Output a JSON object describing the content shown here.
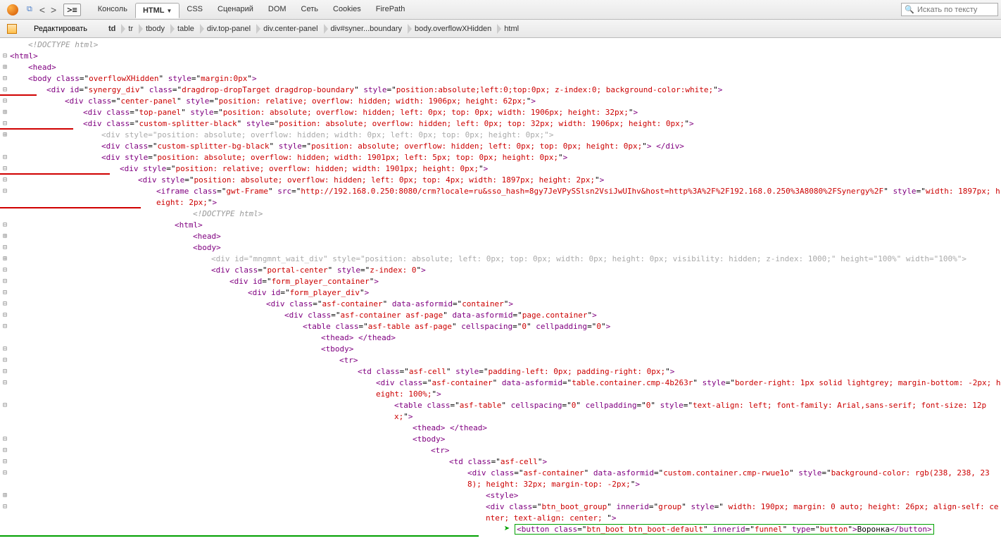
{
  "toolbar": {
    "tabs": [
      "Консоль",
      "HTML",
      "CSS",
      "Сценарий",
      "DOM",
      "Сеть",
      "Cookies",
      "FirePath"
    ],
    "active_tab": "HTML",
    "search_placeholder": "Искать по тексту",
    "edit_label": "Редактировать"
  },
  "breadcrumb": [
    "td",
    "tr",
    "tbody",
    "table",
    "div.top-panel",
    "div.center-panel",
    "div#syner...boundary",
    "body.overflowXHidden",
    "html"
  ],
  "tree": [
    {
      "d": 1,
      "tw": "",
      "cls": "c-doctype",
      "html": "&lt;!DOCTYPE html&gt;"
    },
    {
      "d": 0,
      "tw": "⊟",
      "html": "<span class='c-br'>&lt;</span><span class='c-tag'>html</span><span class='c-br'>&gt;</span>"
    },
    {
      "d": 1,
      "tw": "⊞",
      "html": "<span class='c-br'>&lt;</span><span class='c-tag'>head</span><span class='c-br'>&gt;</span>"
    },
    {
      "d": 1,
      "tw": "⊟",
      "html": "<span class='c-br'>&lt;</span><span class='c-tag'>body</span> <span class='c-attr'>class</span>=\"<span class='c-val'>overflowXHidden</span>\" <span class='c-attr'>style</span>=\"<span class='c-val'>margin:0px</span>\"<span class='c-br'>&gt;</span>"
    },
    {
      "d": 2,
      "tw": "⊟",
      "red": 1,
      "html": "<span class='c-br'>&lt;</span><span class='c-tag'>div</span> <span class='c-attr'>id</span>=\"<span class='c-val'>synergy_div</span>\" <span class='c-attr'>class</span>=\"<span class='c-val'>dragdrop-dropTarget dragdrop-boundary</span>\" <span class='c-attr'>style</span>=\"<span class='c-val'>position:absolute;left:0;top:0px; z-index:0; background-color:white;</span>\"<span class='c-br'>&gt;</span>"
    },
    {
      "d": 3,
      "tw": "⊟",
      "html": "<span class='c-br'>&lt;</span><span class='c-tag'>div</span> <span class='c-attr'>class</span>=\"<span class='c-val'>center-panel</span>\" <span class='c-attr'>style</span>=\"<span class='c-val'>position: relative; overflow: hidden; width: 1906px; height: 62px;</span>\"<span class='c-br'>&gt;</span>"
    },
    {
      "d": 4,
      "tw": "⊞",
      "html": "<span class='c-br'>&lt;</span><span class='c-tag'>div</span> <span class='c-attr'>class</span>=\"<span class='c-val'>top-panel</span>\" <span class='c-attr'>style</span>=\"<span class='c-val'>position: absolute; overflow: hidden; left: 0px; top: 0px; width: 1906px; height: 32px;</span>\"<span class='c-br'>&gt;</span>"
    },
    {
      "d": 4,
      "tw": "⊟",
      "red": 1,
      "html": "<span class='c-br'>&lt;</span><span class='c-tag'>div</span> <span class='c-attr'>class</span>=\"<span class='c-val'>custom-splitter-black</span>\" <span class='c-attr'>style</span>=\"<span class='c-val'>position: absolute; overflow: hidden; left: 0px; top: 32px; width: 1906px; height: 0px;</span>\"<span class='c-br'>&gt;</span>"
    },
    {
      "d": 5,
      "tw": "⊞",
      "grey": 1,
      "html": "<span class='c-br'>&lt;</span><span class='c-tag'>div</span> <span class='c-attr'>style</span>=\"<span class='c-val'>position: absolute; overflow: hidden; width: 0px; left: 0px; top: 0px; height: 0px;</span>\"<span class='c-br'>&gt;</span>"
    },
    {
      "d": 5,
      "tw": "",
      "html": "<span class='c-br'>&lt;</span><span class='c-tag'>div</span> <span class='c-attr'>class</span>=\"<span class='c-val'>custom-splitter-bg-black</span>\" <span class='c-attr'>style</span>=\"<span class='c-val'>position: absolute; overflow: hidden; left: 0px; top: 0px; height: 0px;</span>\"<span class='c-br'>&gt;</span> <span class='c-br'>&lt;/</span><span class='c-tag'>div</span><span class='c-br'>&gt;</span>"
    },
    {
      "d": 5,
      "tw": "⊟",
      "html": "<span class='c-br'>&lt;</span><span class='c-tag'>div</span> <span class='c-attr'>style</span>=\"<span class='c-val'>position: absolute; overflow: hidden; width: 1901px; left: 5px; top: 0px; height: 0px;</span>\"<span class='c-br'>&gt;</span>"
    },
    {
      "d": 6,
      "tw": "⊟",
      "red": 1,
      "html": "<span class='c-br'>&lt;</span><span class='c-tag'>div</span> <span class='c-attr'>style</span>=\"<span class='c-val'>position: relative; overflow: hidden; width: 1901px; height: 0px;</span>\"<span class='c-br'>&gt;</span>"
    },
    {
      "d": 7,
      "tw": "⊟",
      "html": "<span class='c-br'>&lt;</span><span class='c-tag'>div</span> <span class='c-attr'>style</span>=\"<span class='c-val'>position: absolute; overflow: hidden; left: 0px; top: 4px; width: 1897px; height: 2px;</span>\"<span class='c-br'>&gt;</span>"
    },
    {
      "d": 8,
      "tw": "⊟",
      "redshort": 1,
      "html": "<span class='c-br'>&lt;</span><span class='c-tag'>iframe</span> <span class='c-attr'>class</span>=\"<span class='c-val'>gwt-Frame</span>\" <span class='c-attr'>src</span>=\"<span class='c-val'>http://192.168.0.250:8080/crm?locale=ru&amp;sso_hash=8gy7JeVPySSlsn2VsiJwUIhv&amp;host=http%3A%2F%2F192.168.0.250%3A8080%2FSynergy%2F</span>\" <span class='c-attr'>style</span>=\"<span class='c-val'>width: 1897px; height: 2px;</span>\"<span class='c-br'>&gt;</span>"
    },
    {
      "d": 10,
      "tw": "",
      "cls": "c-doctype",
      "html": "&lt;!DOCTYPE html&gt;"
    },
    {
      "d": 9,
      "tw": "⊟",
      "html": "<span class='c-br'>&lt;</span><span class='c-tag'>html</span><span class='c-br'>&gt;</span>"
    },
    {
      "d": 10,
      "tw": "⊞",
      "html": "<span class='c-br'>&lt;</span><span class='c-tag'>head</span><span class='c-br'>&gt;</span>"
    },
    {
      "d": 10,
      "tw": "⊟",
      "html": "<span class='c-br'>&lt;</span><span class='c-tag'>body</span><span class='c-br'>&gt;</span>"
    },
    {
      "d": 11,
      "tw": "⊞",
      "grey": 1,
      "html": "<span class='c-br'>&lt;</span><span class='c-tag'>div</span> <span class='c-attr'>id</span>=\"<span class='c-val'>mngmnt_wait_div</span>\" <span class='c-attr'>style</span>=\"<span class='c-val'>position: absolute; left: 0px; top: 0px; width: 0px; height: 0px; visibility: hidden; z-index: 1000;</span>\" <span class='c-attr'>height</span>=\"<span class='c-val'>100%</span>\" <span class='c-attr'>width</span>=\"<span class='c-val'>100%</span>\"<span class='c-br'>&gt;</span>"
    },
    {
      "d": 11,
      "tw": "⊟",
      "html": "<span class='c-br'>&lt;</span><span class='c-tag'>div</span> <span class='c-attr'>class</span>=\"<span class='c-val'>portal-center</span>\" <span class='c-attr'>style</span>=\"<span class='c-val'>z-index: 0</span>\"<span class='c-br'>&gt;</span>"
    },
    {
      "d": 12,
      "tw": "⊟",
      "html": "<span class='c-br'>&lt;</span><span class='c-tag'>div</span> <span class='c-attr'>id</span>=\"<span class='c-val'>form_player_container</span>\"<span class='c-br'>&gt;</span>"
    },
    {
      "d": 13,
      "tw": "⊟",
      "html": "<span class='c-br'>&lt;</span><span class='c-tag'>div</span> <span class='c-attr'>id</span>=\"<span class='c-val'>form_player_div</span>\"<span class='c-br'>&gt;</span>"
    },
    {
      "d": 14,
      "tw": "⊟",
      "html": "<span class='c-br'>&lt;</span><span class='c-tag'>div</span> <span class='c-attr'>class</span>=\"<span class='c-val'>asf-container</span>\" <span class='c-attr'>data-asformid</span>=\"<span class='c-val'>container</span>\"<span class='c-br'>&gt;</span>"
    },
    {
      "d": 15,
      "tw": "⊟",
      "html": "<span class='c-br'>&lt;</span><span class='c-tag'>div</span> <span class='c-attr'>class</span>=\"<span class='c-val'>asf-container asf-page</span>\" <span class='c-attr'>data-asformid</span>=\"<span class='c-val'>page.container</span>\"<span class='c-br'>&gt;</span>"
    },
    {
      "d": 16,
      "tw": "⊟",
      "html": "<span class='c-br'>&lt;</span><span class='c-tag'>table</span> <span class='c-attr'>class</span>=\"<span class='c-val'>asf-table asf-page</span>\" <span class='c-attr'>cellspacing</span>=\"<span class='c-val'>0</span>\" <span class='c-attr'>cellpadding</span>=\"<span class='c-val'>0</span>\"<span class='c-br'>&gt;</span>"
    },
    {
      "d": 17,
      "tw": "",
      "html": "<span class='c-br'>&lt;</span><span class='c-tag'>thead</span><span class='c-br'>&gt;</span> <span class='c-br'>&lt;/</span><span class='c-tag'>thead</span><span class='c-br'>&gt;</span>"
    },
    {
      "d": 17,
      "tw": "⊟",
      "html": "<span class='c-br'>&lt;</span><span class='c-tag'>tbody</span><span class='c-br'>&gt;</span>"
    },
    {
      "d": 18,
      "tw": "⊟",
      "html": "<span class='c-br'>&lt;</span><span class='c-tag'>tr</span><span class='c-br'>&gt;</span>"
    },
    {
      "d": 19,
      "tw": "⊟",
      "html": "<span class='c-br'>&lt;</span><span class='c-tag'>td</span> <span class='c-attr'>class</span>=\"<span class='c-val'>asf-cell</span>\" <span class='c-attr'>style</span>=\"<span class='c-val'>padding-left: 0px; padding-right: 0px;</span>\"<span class='c-br'>&gt;</span>"
    },
    {
      "d": 20,
      "tw": "⊟",
      "html": "<span class='c-br'>&lt;</span><span class='c-tag'>div</span> <span class='c-attr'>class</span>=\"<span class='c-val'>asf-container</span>\" <span class='c-attr'>data-asformid</span>=\"<span class='c-val'>table.container.cmp-4b263r</span>\" <span class='c-attr'>style</span>=\"<span class='c-val'>border-right: 1px solid lightgrey; margin-bottom: -2px; height: 100%;</span>\"<span class='c-br'>&gt;</span>"
    },
    {
      "d": 21,
      "tw": "⊟",
      "html": "<span class='c-br'>&lt;</span><span class='c-tag'>table</span> <span class='c-attr'>class</span>=\"<span class='c-val'>asf-table</span>\" <span class='c-attr'>cellspacing</span>=\"<span class='c-val'>0</span>\" <span class='c-attr'>cellpadding</span>=\"<span class='c-val'>0</span>\" <span class='c-attr'>style</span>=\"<span class='c-val'>text-align: left; font-family: Arial,sans-serif; font-size: 12px;</span>\"<span class='c-br'>&gt;</span>"
    },
    {
      "d": 22,
      "tw": "",
      "html": "<span class='c-br'>&lt;</span><span class='c-tag'>thead</span><span class='c-br'>&gt;</span> <span class='c-br'>&lt;/</span><span class='c-tag'>thead</span><span class='c-br'>&gt;</span>"
    },
    {
      "d": 22,
      "tw": "⊟",
      "html": "<span class='c-br'>&lt;</span><span class='c-tag'>tbody</span><span class='c-br'>&gt;</span>"
    },
    {
      "d": 23,
      "tw": "⊟",
      "html": "<span class='c-br'>&lt;</span><span class='c-tag'>tr</span><span class='c-br'>&gt;</span>"
    },
    {
      "d": 24,
      "tw": "⊟",
      "html": "<span class='c-br'>&lt;</span><span class='c-tag'>td</span> <span class='c-attr'>class</span>=\"<span class='c-val'>asf-cell</span>\"<span class='c-br'>&gt;</span>"
    },
    {
      "d": 25,
      "tw": "⊟",
      "html": "<span class='c-br'>&lt;</span><span class='c-tag'>div</span> <span class='c-attr'>class</span>=\"<span class='c-val'>asf-container</span>\" <span class='c-attr'>data-asformid</span>=\"<span class='c-val'>custom.container.cmp-rwue1o</span>\" <span class='c-attr'>style</span>=\"<span class='c-val'>background-color: rgb(238, 238, 238); height: 32px; margin-top: -2px;</span>\"<span class='c-br'>&gt;</span>"
    },
    {
      "d": 26,
      "tw": "⊞",
      "html": "<span class='c-br'>&lt;</span><span class='c-tag'>style</span><span class='c-br'>&gt;</span>"
    },
    {
      "d": 26,
      "tw": "⊟",
      "html": "<span class='c-br'>&lt;</span><span class='c-tag'>div</span> <span class='c-attr'>class</span>=\"<span class='c-val'>btn_boot_group</span>\" <span class='c-attr'>innerid</span>=\"<span class='c-val'>group</span>\" <span class='c-attr'>style</span>=\"<span class='c-val'> width: 190px; margin: 0 auto; height: 26px; align-self: center; text-align: center; </span>\"<span class='c-br'>&gt;</span>"
    },
    {
      "d": 27,
      "tw": "",
      "green": 1,
      "html": "<span class='c-br'>&lt;</span><span class='c-tag'>button</span> <span class='c-attr'>class</span>=\"<span class='c-val'>btn_boot btn_boot-default</span>\" <span class='c-attr'>innerid</span>=\"<span class='c-val'>funnel</span>\" <span class='c-attr'>type</span>=\"<span class='c-val'>button</span>\"<span class='c-br'>&gt;</span><span class='c-text'>Воронка</span><span class='c-br'>&lt;/</span><span class='c-tag'>button</span><span class='c-br'>&gt;</span>"
    }
  ]
}
